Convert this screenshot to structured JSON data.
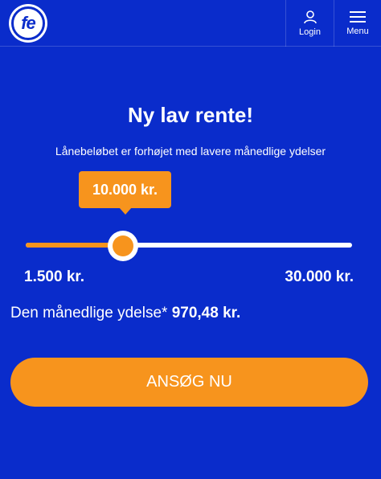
{
  "header": {
    "logo_text": "fe",
    "login_label": "Login",
    "menu_label": "Menu"
  },
  "hero": {
    "title": "Ny lav rente!",
    "subtitle": "Lånebeløbet er forhøjet med lavere månedlige ydelser"
  },
  "slider": {
    "current_label": "10.000 kr.",
    "min_label": "1.500 kr.",
    "max_label": "30.000 kr.",
    "min": 1500,
    "max": 30000,
    "value": 10000
  },
  "payment": {
    "label": "Den månedlige ydelse*",
    "value": "970,48 kr."
  },
  "cta": {
    "label": "ANSØG NU"
  },
  "colors": {
    "background": "#0a2ccb",
    "accent": "#f7941d",
    "text": "#ffffff"
  },
  "icons": {
    "logo": "fe-logo-icon",
    "login": "user-icon",
    "menu": "hamburger-menu-icon"
  }
}
